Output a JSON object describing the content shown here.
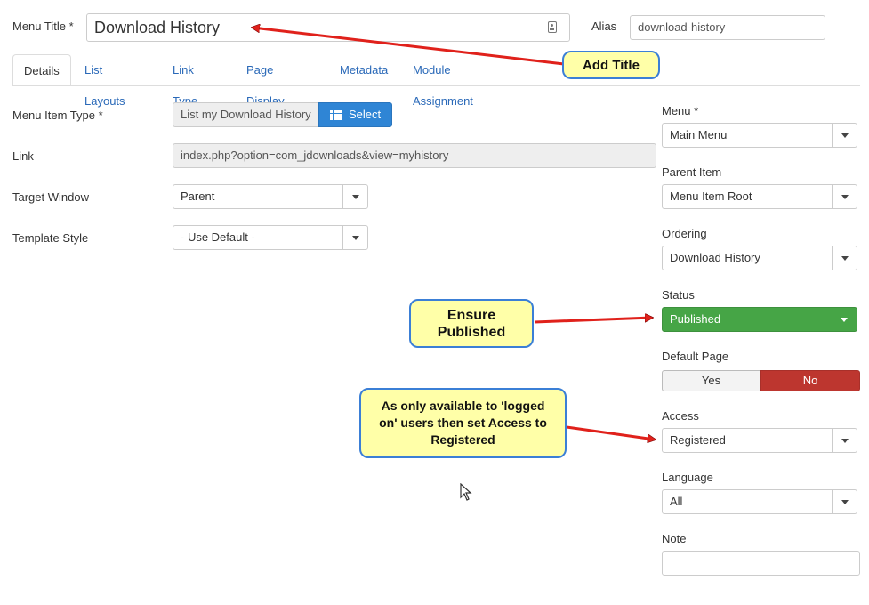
{
  "menu_title": {
    "label": "Menu Title *",
    "value": "Download History"
  },
  "alias": {
    "label": "Alias",
    "value": "download-history"
  },
  "tabs": [
    "Details",
    "List Layouts",
    "Link Type",
    "Page Display",
    "Metadata",
    "Module Assignment"
  ],
  "details": {
    "menu_item_type": {
      "label": "Menu Item Type *",
      "value": "List my Download History",
      "button": "Select"
    },
    "link": {
      "label": "Link",
      "value": "index.php?option=com_jdownloads&view=myhistory"
    },
    "target_window": {
      "label": "Target Window",
      "value": "Parent"
    },
    "template_style": {
      "label": "Template Style",
      "value": "- Use Default -"
    }
  },
  "side": {
    "menu": {
      "label": "Menu *",
      "value": "Main Menu"
    },
    "parent_item": {
      "label": "Parent Item",
      "value": "Menu Item Root"
    },
    "ordering": {
      "label": "Ordering",
      "value": "Download History"
    },
    "status": {
      "label": "Status",
      "value": "Published"
    },
    "default_page": {
      "label": "Default Page",
      "yes": "Yes",
      "no": "No"
    },
    "access": {
      "label": "Access",
      "value": "Registered"
    },
    "language": {
      "label": "Language",
      "value": "All"
    },
    "note": {
      "label": "Note",
      "value": ""
    }
  },
  "annotations": {
    "add_title": "Add Title",
    "ensure_published": "Ensure Published",
    "access_note": "As only available to 'logged on' users then set Access to Registered"
  },
  "colors": {
    "published": "#46a546",
    "no_active": "#bd362f",
    "link": "#2a69b8",
    "callout_bg": "#ffffa8",
    "callout_border": "#3b7fd6",
    "arrow": "#e0211b"
  }
}
